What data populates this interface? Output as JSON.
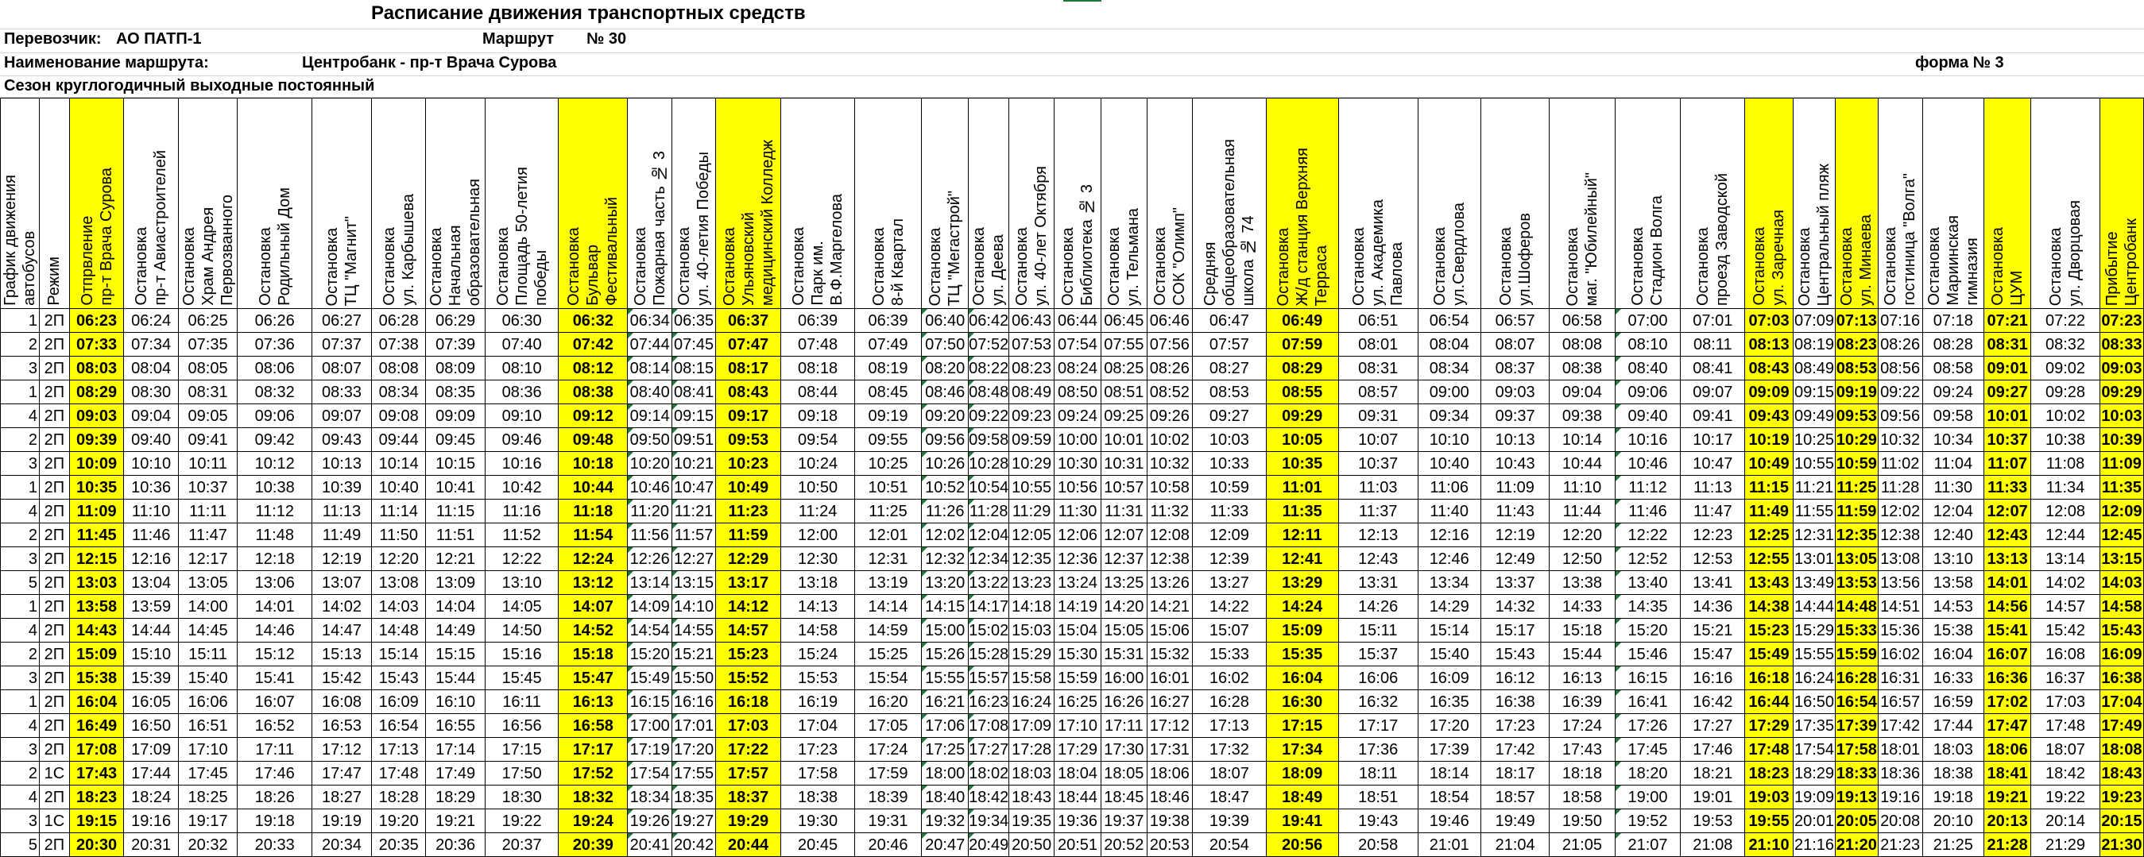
{
  "header": {
    "title": "Расписание движения транспортных средств",
    "carrier_label": "Перевозчик:",
    "carrier": "АО ПАТП-1",
    "route_label": "Маршрут",
    "route_number": "№ 30",
    "route_name_label": "Наименование маршрута:",
    "route_name": "Центробанк  -  пр-т Врача Сурова",
    "form": "форма № 3",
    "season": "Сезон круглогодичный выходные постоянный"
  },
  "columns": [
    {
      "label": "График движения\nавтобусов",
      "w": 33
    },
    {
      "label": "Режим",
      "w": 42
    },
    {
      "label": "Отпрвление\nпр-т Врача Сурова",
      "w": 75,
      "yellow": true,
      "bold": true
    },
    {
      "label": "Остановка\nпр-т Авиастроителей",
      "w": 75
    },
    {
      "label": "Остановка\nХрам Андрея\nПервозванного",
      "w": 75
    },
    {
      "label": "Остановка\nРодильный Дом",
      "w": 110
    },
    {
      "label": "Остановка\nТЦ \"Магнит\"",
      "w": 84
    },
    {
      "label": "Остановка\nул. Карбышева",
      "w": 75
    },
    {
      "label": "Остановка\nНачальная\nобразовательная",
      "w": 75
    },
    {
      "label": "Остановка\nПлощадь 50-летия\nпобеды",
      "w": 100
    },
    {
      "label": "Остановка\nБульвар\nФестивальный",
      "w": 92,
      "yellow": true,
      "bold": true
    },
    {
      "label": "Остановка\nПожарная часть № 3",
      "w": 58
    },
    {
      "label": "Остановка\nул. 40-летия Победы",
      "w": 56
    },
    {
      "label": "Остановка\nУльяновский\nмедицинский Колледж",
      "w": 86,
      "yellow": true,
      "bold": true
    },
    {
      "label": "Остановка\nПарк им.\nВ.Ф.Маргелова",
      "w": 100
    },
    {
      "label": "Остановка\n8-й Квартал",
      "w": 97
    },
    {
      "label": "Остановка\nТЦ \"Мегастрой\"",
      "w": 62
    },
    {
      "label": "Остановка\nул. Деева",
      "w": 49
    },
    {
      "label": "Остановка\nул. 40-лет Октября",
      "w": 59
    },
    {
      "label": "Остановка\nБиблиотека № 3",
      "w": 62
    },
    {
      "label": "Остановка\nул. Тельмана",
      "w": 60
    },
    {
      "label": "Остановка\nСОК \"Олимп\"",
      "w": 60
    },
    {
      "label": "Средняя\nобщеобразовательная\nшкола № 74",
      "w": 100
    },
    {
      "label": "Остановка\nЖ/д станция Верхняя\nТерраса",
      "w": 98,
      "yellow": true,
      "bold": true
    },
    {
      "label": "Остановка\nул. Академика\nПавлова",
      "w": 110
    },
    {
      "label": "Остановка\nул.Свердлова",
      "w": 90
    },
    {
      "label": "Остановка\nул.Шоферов",
      "w": 100
    },
    {
      "label": "Остановка\nмаг. \"Юбилейный\"",
      "w": 94
    },
    {
      "label": "Остановка\nСтадион Волга",
      "w": 95
    },
    {
      "label": "Остановка\nпроезд Заводской",
      "w": 92
    },
    {
      "label": "Остановка\nул. Заречная",
      "w": 64,
      "yellow": true,
      "bold": true
    },
    {
      "label": "Остановка\nЦентральный пляж",
      "w": 54
    },
    {
      "label": "Остановка\nул. Минаева",
      "w": 54,
      "yellow": true,
      "bold": true
    },
    {
      "label": "Остановка\nгостиница \"Волга\"",
      "w": 58
    },
    {
      "label": "Остановка\nМариинская\nгимназия",
      "w": 79
    },
    {
      "label": "Остановка\nЦУМ",
      "w": 62,
      "yellow": true,
      "bold": true
    },
    {
      "label": "Остановка\nул. Дворцовая",
      "w": 100
    },
    {
      "label": "Прибытие\nЦентробанк",
      "w": 56,
      "yellow": true,
      "bold": true
    }
  ],
  "rows": [
    [
      "1",
      "2П",
      "06:23",
      "06:24",
      "06:25",
      "06:26",
      "06:27",
      "06:28",
      "06:29",
      "06:30",
      "06:32",
      "06:34",
      "06:35",
      "06:37",
      "06:39",
      "06:39",
      "06:40",
      "06:42",
      "06:43",
      "06:44",
      "06:45",
      "06:46",
      "06:47",
      "06:49",
      "06:51",
      "06:54",
      "06:57",
      "06:58",
      "07:00",
      "07:01",
      "07:03",
      "07:09",
      "07:13",
      "07:16",
      "07:18",
      "07:21",
      "07:22",
      "07:23"
    ],
    [
      "2",
      "2П",
      "07:33",
      "07:34",
      "07:35",
      "07:36",
      "07:37",
      "07:38",
      "07:39",
      "07:40",
      "07:42",
      "07:44",
      "07:45",
      "07:47",
      "07:48",
      "07:49",
      "07:50",
      "07:52",
      "07:53",
      "07:54",
      "07:55",
      "07:56",
      "07:57",
      "07:59",
      "08:01",
      "08:04",
      "08:07",
      "08:08",
      "08:10",
      "08:11",
      "08:13",
      "08:19",
      "08:23",
      "08:26",
      "08:28",
      "08:31",
      "08:32",
      "08:33"
    ],
    [
      "3",
      "2П",
      "08:03",
      "08:04",
      "08:05",
      "08:06",
      "08:07",
      "08:08",
      "08:09",
      "08:10",
      "08:12",
      "08:14",
      "08:15",
      "08:17",
      "08:18",
      "08:19",
      "08:20",
      "08:22",
      "08:23",
      "08:24",
      "08:25",
      "08:26",
      "08:27",
      "08:29",
      "08:31",
      "08:34",
      "08:37",
      "08:38",
      "08:40",
      "08:41",
      "08:43",
      "08:49",
      "08:53",
      "08:56",
      "08:58",
      "09:01",
      "09:02",
      "09:03"
    ],
    [
      "1",
      "2П",
      "08:29",
      "08:30",
      "08:31",
      "08:32",
      "08:33",
      "08:34",
      "08:35",
      "08:36",
      "08:38",
      "08:40",
      "08:41",
      "08:43",
      "08:44",
      "08:45",
      "08:46",
      "08:48",
      "08:49",
      "08:50",
      "08:51",
      "08:52",
      "08:53",
      "08:55",
      "08:57",
      "09:00",
      "09:03",
      "09:04",
      "09:06",
      "09:07",
      "09:09",
      "09:15",
      "09:19",
      "09:22",
      "09:24",
      "09:27",
      "09:28",
      "09:29"
    ],
    [
      "4",
      "2П",
      "09:03",
      "09:04",
      "09:05",
      "09:06",
      "09:07",
      "09:08",
      "09:09",
      "09:10",
      "09:12",
      "09:14",
      "09:15",
      "09:17",
      "09:18",
      "09:19",
      "09:20",
      "09:22",
      "09:23",
      "09:24",
      "09:25",
      "09:26",
      "09:27",
      "09:29",
      "09:31",
      "09:34",
      "09:37",
      "09:38",
      "09:40",
      "09:41",
      "09:43",
      "09:49",
      "09:53",
      "09:56",
      "09:58",
      "10:01",
      "10:02",
      "10:03"
    ],
    [
      "2",
      "2П",
      "09:39",
      "09:40",
      "09:41",
      "09:42",
      "09:43",
      "09:44",
      "09:45",
      "09:46",
      "09:48",
      "09:50",
      "09:51",
      "09:53",
      "09:54",
      "09:55",
      "09:56",
      "09:58",
      "09:59",
      "10:00",
      "10:01",
      "10:02",
      "10:03",
      "10:05",
      "10:07",
      "10:10",
      "10:13",
      "10:14",
      "10:16",
      "10:17",
      "10:19",
      "10:25",
      "10:29",
      "10:32",
      "10:34",
      "10:37",
      "10:38",
      "10:39"
    ],
    [
      "3",
      "2П",
      "10:09",
      "10:10",
      "10:11",
      "10:12",
      "10:13",
      "10:14",
      "10:15",
      "10:16",
      "10:18",
      "10:20",
      "10:21",
      "10:23",
      "10:24",
      "10:25",
      "10:26",
      "10:28",
      "10:29",
      "10:30",
      "10:31",
      "10:32",
      "10:33",
      "10:35",
      "10:37",
      "10:40",
      "10:43",
      "10:44",
      "10:46",
      "10:47",
      "10:49",
      "10:55",
      "10:59",
      "11:02",
      "11:04",
      "11:07",
      "11:08",
      "11:09"
    ],
    [
      "1",
      "2П",
      "10:35",
      "10:36",
      "10:37",
      "10:38",
      "10:39",
      "10:40",
      "10:41",
      "10:42",
      "10:44",
      "10:46",
      "10:47",
      "10:49",
      "10:50",
      "10:51",
      "10:52",
      "10:54",
      "10:55",
      "10:56",
      "10:57",
      "10:58",
      "10:59",
      "11:01",
      "11:03",
      "11:06",
      "11:09",
      "11:10",
      "11:12",
      "11:13",
      "11:15",
      "11:21",
      "11:25",
      "11:28",
      "11:30",
      "11:33",
      "11:34",
      "11:35"
    ],
    [
      "4",
      "2П",
      "11:09",
      "11:10",
      "11:11",
      "11:12",
      "11:13",
      "11:14",
      "11:15",
      "11:16",
      "11:18",
      "11:20",
      "11:21",
      "11:23",
      "11:24",
      "11:25",
      "11:26",
      "11:28",
      "11:29",
      "11:30",
      "11:31",
      "11:32",
      "11:33",
      "11:35",
      "11:37",
      "11:40",
      "11:43",
      "11:44",
      "11:46",
      "11:47",
      "11:49",
      "11:55",
      "11:59",
      "12:02",
      "12:04",
      "12:07",
      "12:08",
      "12:09"
    ],
    [
      "2",
      "2П",
      "11:45",
      "11:46",
      "11:47",
      "11:48",
      "11:49",
      "11:50",
      "11:51",
      "11:52",
      "11:54",
      "11:56",
      "11:57",
      "11:59",
      "12:00",
      "12:01",
      "12:02",
      "12:04",
      "12:05",
      "12:06",
      "12:07",
      "12:08",
      "12:09",
      "12:11",
      "12:13",
      "12:16",
      "12:19",
      "12:20",
      "12:22",
      "12:23",
      "12:25",
      "12:31",
      "12:35",
      "12:38",
      "12:40",
      "12:43",
      "12:44",
      "12:45"
    ],
    [
      "3",
      "2П",
      "12:15",
      "12:16",
      "12:17",
      "12:18",
      "12:19",
      "12:20",
      "12:21",
      "12:22",
      "12:24",
      "12:26",
      "12:27",
      "12:29",
      "12:30",
      "12:31",
      "12:32",
      "12:34",
      "12:35",
      "12:36",
      "12:37",
      "12:38",
      "12:39",
      "12:41",
      "12:43",
      "12:46",
      "12:49",
      "12:50",
      "12:52",
      "12:53",
      "12:55",
      "13:01",
      "13:05",
      "13:08",
      "13:10",
      "13:13",
      "13:14",
      "13:15"
    ],
    [
      "5",
      "2П",
      "13:03",
      "13:04",
      "13:05",
      "13:06",
      "13:07",
      "13:08",
      "13:09",
      "13:10",
      "13:12",
      "13:14",
      "13:15",
      "13:17",
      "13:18",
      "13:19",
      "13:20",
      "13:22",
      "13:23",
      "13:24",
      "13:25",
      "13:26",
      "13:27",
      "13:29",
      "13:31",
      "13:34",
      "13:37",
      "13:38",
      "13:40",
      "13:41",
      "13:43",
      "13:49",
      "13:53",
      "13:56",
      "13:58",
      "14:01",
      "14:02",
      "14:03"
    ],
    [
      "1",
      "2П",
      "13:58",
      "13:59",
      "14:00",
      "14:01",
      "14:02",
      "14:03",
      "14:04",
      "14:05",
      "14:07",
      "14:09",
      "14:10",
      "14:12",
      "14:13",
      "14:14",
      "14:15",
      "14:17",
      "14:18",
      "14:19",
      "14:20",
      "14:21",
      "14:22",
      "14:24",
      "14:26",
      "14:29",
      "14:32",
      "14:33",
      "14:35",
      "14:36",
      "14:38",
      "14:44",
      "14:48",
      "14:51",
      "14:53",
      "14:56",
      "14:57",
      "14:58"
    ],
    [
      "4",
      "2П",
      "14:43",
      "14:44",
      "14:45",
      "14:46",
      "14:47",
      "14:48",
      "14:49",
      "14:50",
      "14:52",
      "14:54",
      "14:55",
      "14:57",
      "14:58",
      "14:59",
      "15:00",
      "15:02",
      "15:03",
      "15:04",
      "15:05",
      "15:06",
      "15:07",
      "15:09",
      "15:11",
      "15:14",
      "15:17",
      "15:18",
      "15:20",
      "15:21",
      "15:23",
      "15:29",
      "15:33",
      "15:36",
      "15:38",
      "15:41",
      "15:42",
      "15:43"
    ],
    [
      "2",
      "2П",
      "15:09",
      "15:10",
      "15:11",
      "15:12",
      "15:13",
      "15:14",
      "15:15",
      "15:16",
      "15:18",
      "15:20",
      "15:21",
      "15:23",
      "15:24",
      "15:25",
      "15:26",
      "15:28",
      "15:29",
      "15:30",
      "15:31",
      "15:32",
      "15:33",
      "15:35",
      "15:37",
      "15:40",
      "15:43",
      "15:44",
      "15:46",
      "15:47",
      "15:49",
      "15:55",
      "15:59",
      "16:02",
      "16:04",
      "16:07",
      "16:08",
      "16:09"
    ],
    [
      "3",
      "2П",
      "15:38",
      "15:39",
      "15:40",
      "15:41",
      "15:42",
      "15:43",
      "15:44",
      "15:45",
      "15:47",
      "15:49",
      "15:50",
      "15:52",
      "15:53",
      "15:54",
      "15:55",
      "15:57",
      "15:58",
      "15:59",
      "16:00",
      "16:01",
      "16:02",
      "16:04",
      "16:06",
      "16:09",
      "16:12",
      "16:13",
      "16:15",
      "16:16",
      "16:18",
      "16:24",
      "16:28",
      "16:31",
      "16:33",
      "16:36",
      "16:37",
      "16:38"
    ],
    [
      "1",
      "2П",
      "16:04",
      "16:05",
      "16:06",
      "16:07",
      "16:08",
      "16:09",
      "16:10",
      "16:11",
      "16:13",
      "16:15",
      "16:16",
      "16:18",
      "16:19",
      "16:20",
      "16:21",
      "16:23",
      "16:24",
      "16:25",
      "16:26",
      "16:27",
      "16:28",
      "16:30",
      "16:32",
      "16:35",
      "16:38",
      "16:39",
      "16:41",
      "16:42",
      "16:44",
      "16:50",
      "16:54",
      "16:57",
      "16:59",
      "17:02",
      "17:03",
      "17:04"
    ],
    [
      "4",
      "2П",
      "16:49",
      "16:50",
      "16:51",
      "16:52",
      "16:53",
      "16:54",
      "16:55",
      "16:56",
      "16:58",
      "17:00",
      "17:01",
      "17:03",
      "17:04",
      "17:05",
      "17:06",
      "17:08",
      "17:09",
      "17:10",
      "17:11",
      "17:12",
      "17:13",
      "17:15",
      "17:17",
      "17:20",
      "17:23",
      "17:24",
      "17:26",
      "17:27",
      "17:29",
      "17:35",
      "17:39",
      "17:42",
      "17:44",
      "17:47",
      "17:48",
      "17:49"
    ],
    [
      "3",
      "2П",
      "17:08",
      "17:09",
      "17:10",
      "17:11",
      "17:12",
      "17:13",
      "17:14",
      "17:15",
      "17:17",
      "17:19",
      "17:20",
      "17:22",
      "17:23",
      "17:24",
      "17:25",
      "17:27",
      "17:28",
      "17:29",
      "17:30",
      "17:31",
      "17:32",
      "17:34",
      "17:36",
      "17:39",
      "17:42",
      "17:43",
      "17:45",
      "17:46",
      "17:48",
      "17:54",
      "17:58",
      "18:01",
      "18:03",
      "18:06",
      "18:07",
      "18:08"
    ],
    [
      "2",
      "1С",
      "17:43",
      "17:44",
      "17:45",
      "17:46",
      "17:47",
      "17:48",
      "17:49",
      "17:50",
      "17:52",
      "17:54",
      "17:55",
      "17:57",
      "17:58",
      "17:59",
      "18:00",
      "18:02",
      "18:03",
      "18:04",
      "18:05",
      "18:06",
      "18:07",
      "18:09",
      "18:11",
      "18:14",
      "18:17",
      "18:18",
      "18:20",
      "18:21",
      "18:23",
      "18:29",
      "18:33",
      "18:36",
      "18:38",
      "18:41",
      "18:42",
      "18:43"
    ],
    [
      "4",
      "2П",
      "18:23",
      "18:24",
      "18:25",
      "18:26",
      "18:27",
      "18:28",
      "18:29",
      "18:30",
      "18:32",
      "18:34",
      "18:35",
      "18:37",
      "18:38",
      "18:39",
      "18:40",
      "18:42",
      "18:43",
      "18:44",
      "18:45",
      "18:46",
      "18:47",
      "18:49",
      "18:51",
      "18:54",
      "18:57",
      "18:58",
      "19:00",
      "19:01",
      "19:03",
      "19:09",
      "19:13",
      "19:16",
      "19:18",
      "19:21",
      "19:22",
      "19:23"
    ],
    [
      "3",
      "1С",
      "19:15",
      "19:16",
      "19:17",
      "19:18",
      "19:19",
      "19:20",
      "19:21",
      "19:22",
      "19:24",
      "19:26",
      "19:27",
      "19:29",
      "19:30",
      "19:31",
      "19:32",
      "19:34",
      "19:35",
      "19:36",
      "19:37",
      "19:38",
      "19:39",
      "19:41",
      "19:43",
      "19:46",
      "19:49",
      "19:50",
      "19:52",
      "19:53",
      "19:55",
      "20:01",
      "20:05",
      "20:08",
      "20:10",
      "20:13",
      "20:14",
      "20:15"
    ],
    [
      "5",
      "2П",
      "20:30",
      "20:31",
      "20:32",
      "20:33",
      "20:34",
      "20:35",
      "20:36",
      "20:37",
      "20:39",
      "20:41",
      "20:42",
      "20:44",
      "20:45",
      "20:46",
      "20:47",
      "20:49",
      "20:50",
      "20:51",
      "20:52",
      "20:53",
      "20:54",
      "20:56",
      "20:58",
      "21:01",
      "21:04",
      "21:05",
      "21:07",
      "21:08",
      "21:10",
      "21:16",
      "21:20",
      "21:23",
      "21:25",
      "21:28",
      "21:29",
      "21:30"
    ]
  ]
}
